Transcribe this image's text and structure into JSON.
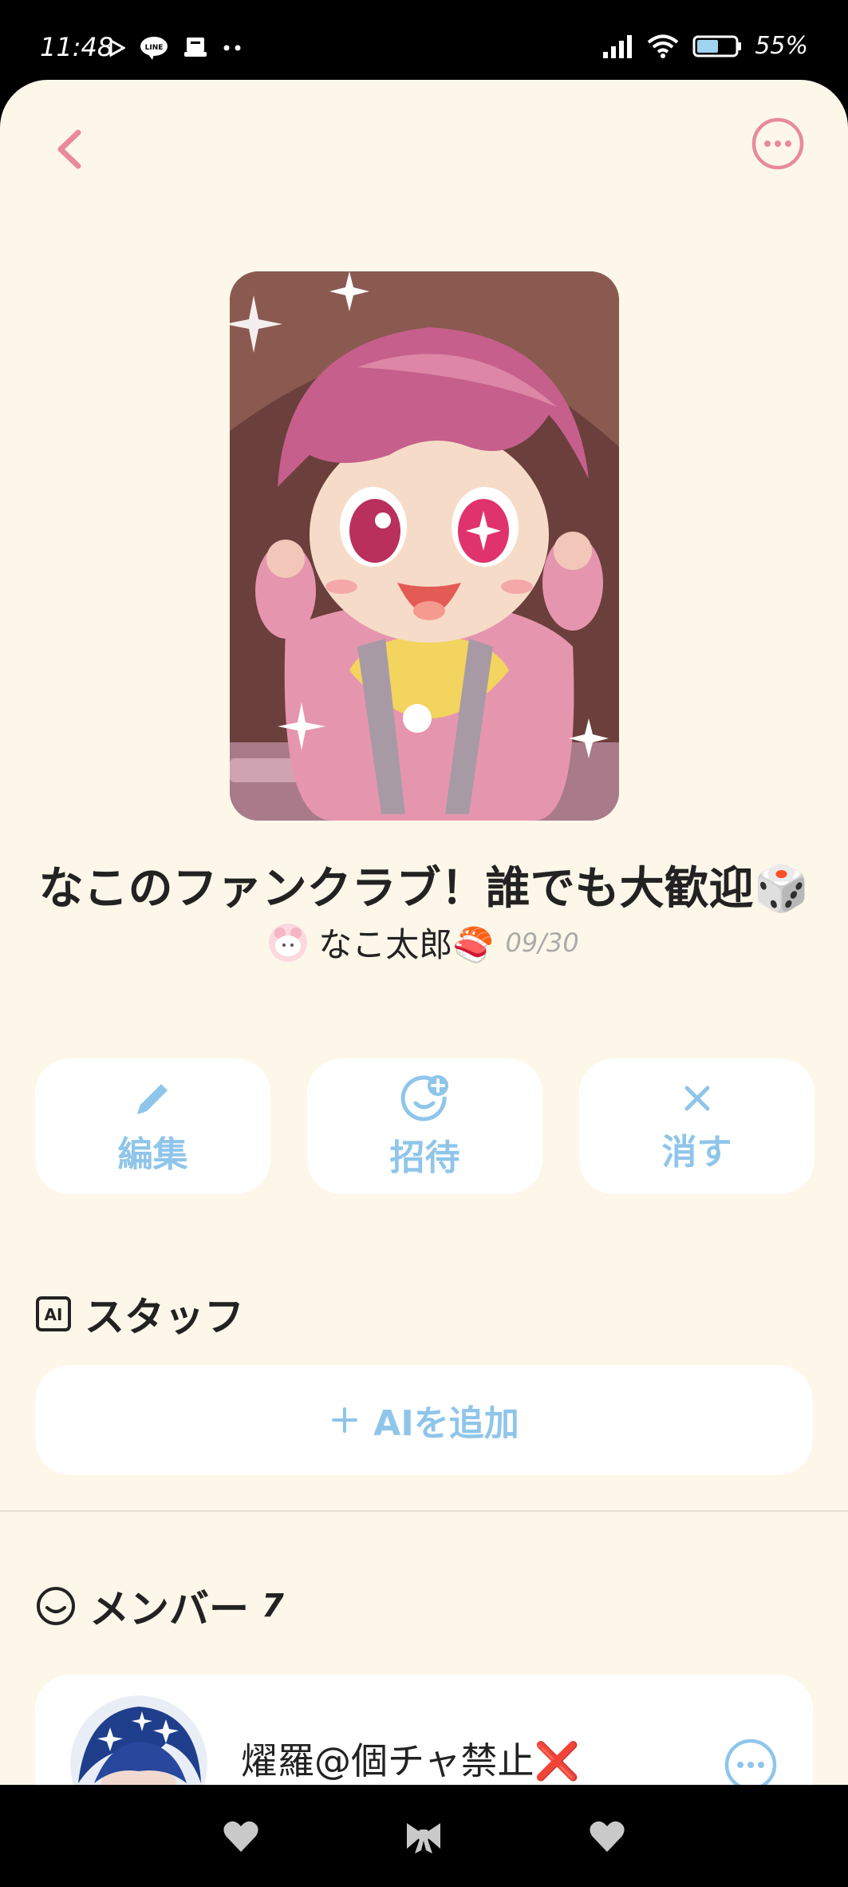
{
  "status_bar": {
    "time": "11:48",
    "battery": "55%",
    "icons": [
      "play-icon",
      "line-app-icon",
      "notification-app-icon",
      "more-dots-icon",
      "signal-icon",
      "wifi-icon",
      "battery-icon"
    ]
  },
  "header": {
    "back_icon": "chevron-left-icon",
    "more_icon": "more-circle-icon",
    "accent_color": "#e88a9c"
  },
  "club": {
    "title": "なこのファンクラブ！誰でも大歓迎🎲",
    "owner_name": "なこ太郎🍣",
    "date": "09/30"
  },
  "actions": [
    {
      "label": "編集",
      "icon": "pencil-icon"
    },
    {
      "label": "招待",
      "icon": "invite-face-plus-icon"
    },
    {
      "label": "消す",
      "icon": "close-icon"
    }
  ],
  "staff_section": {
    "title": "スタッフ",
    "icon": "ai-badge-icon",
    "add_label": "AIを追加",
    "add_icon": "plus-icon"
  },
  "members_section": {
    "title": "メンバー",
    "count": "7",
    "icon": "smile-face-icon"
  },
  "members": [
    {
      "name": "燿羅@個チャ禁止❌"
    }
  ],
  "nav_bar": {
    "icons": [
      "heart-icon",
      "bow-icon",
      "heart-icon"
    ]
  },
  "colors": {
    "background": "#fdf7e9",
    "accent_blue": "#8fc5ea",
    "accent_pink": "#e88a9c"
  }
}
